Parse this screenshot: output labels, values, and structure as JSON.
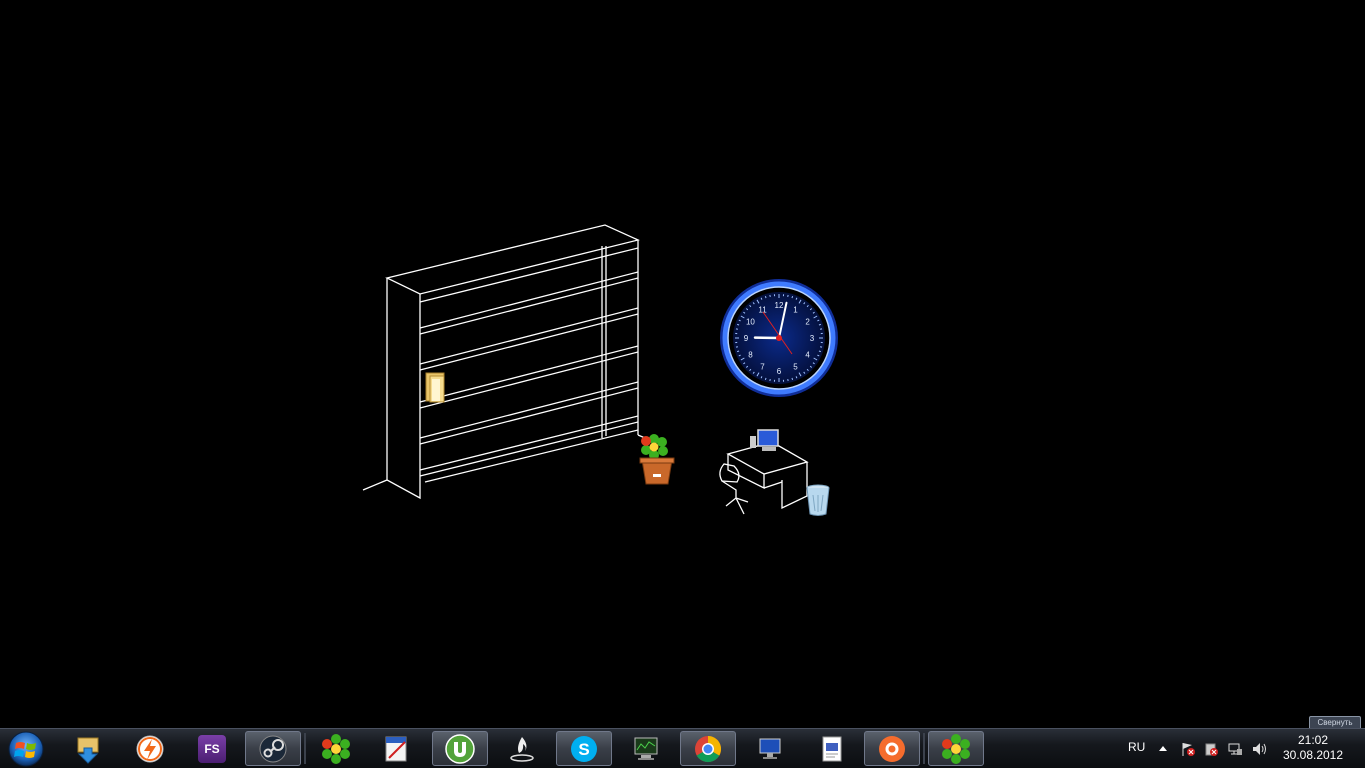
{
  "desktop": {
    "icons": [
      {
        "name": "folder-icon"
      },
      {
        "name": "icq-flowerpot-icon"
      },
      {
        "name": "computer-desk-icon"
      },
      {
        "name": "recycle-bin-icon"
      }
    ],
    "clock": {
      "numbers": [
        "12",
        "1",
        "2",
        "3",
        "4",
        "5",
        "6",
        "7",
        "8",
        "9",
        "10",
        "11"
      ],
      "hour": 21,
      "minute": 2,
      "accent": "#1a4cff"
    }
  },
  "taskbar": {
    "apps": [
      {
        "name": "downloads-icon"
      },
      {
        "name": "flash-icon"
      },
      {
        "name": "fs-icon",
        "label": "FS"
      },
      {
        "name": "steam-icon"
      },
      {
        "name": "icq-icon"
      },
      {
        "name": "editor-icon"
      },
      {
        "name": "utorrent-icon"
      },
      {
        "name": "flame-icon"
      },
      {
        "name": "skype-icon"
      },
      {
        "name": "monitor-icon"
      },
      {
        "name": "chrome-icon"
      },
      {
        "name": "display-icon"
      },
      {
        "name": "document-icon"
      },
      {
        "name": "origin-icon"
      },
      {
        "name": "icq-active-icon"
      }
    ],
    "tray": {
      "language": "RU",
      "time": "21:02",
      "date": "30.08.2012"
    },
    "show_desktop_label": "Свернуть"
  }
}
